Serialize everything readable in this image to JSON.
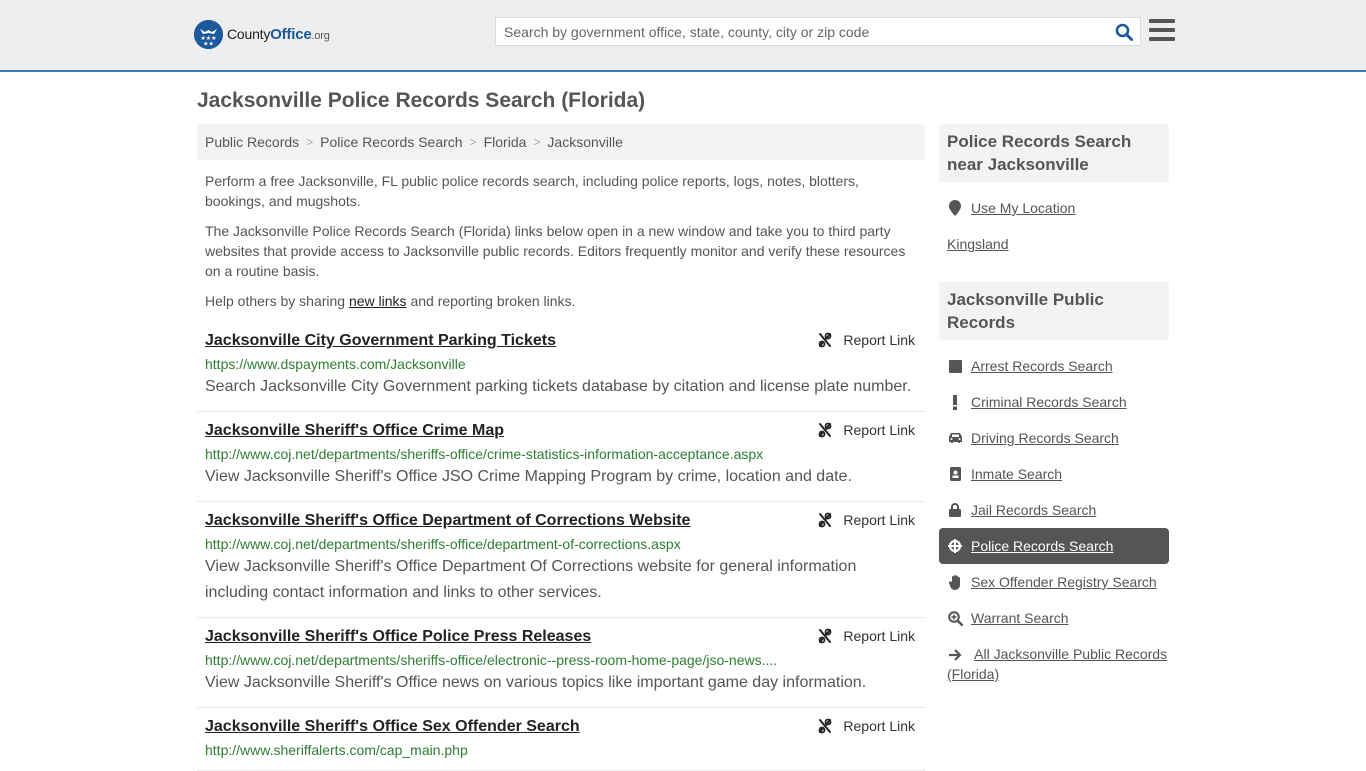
{
  "header": {
    "logo": {
      "name": "County",
      "name_bold": "Office",
      "tld": ".org"
    },
    "search": {
      "placeholder": "Search by government office, state, county, city or zip code",
      "value": ""
    },
    "icons": {
      "search": "search-icon",
      "menu": "hamburger-menu-icon"
    }
  },
  "page": {
    "title": "Jacksonville Police Records Search (Florida)"
  },
  "breadcrumb": [
    {
      "label": "Public Records"
    },
    {
      "label": "Police Records Search"
    },
    {
      "label": "Florida"
    },
    {
      "label": "Jacksonville"
    }
  ],
  "intro": {
    "p1": "Perform a free Jacksonville, FL public police records search, including police reports, logs, notes, blotters, bookings, and mugshots.",
    "p2": "The Jacksonville Police Records Search (Florida) links below open in a new window and take you to third party websites that provide access to Jacksonville public records. Editors frequently monitor and verify these resources on a routine basis.",
    "p3_before": "Help others by sharing ",
    "p3_link": "new links",
    "p3_after": " and reporting broken links."
  },
  "results": [
    {
      "title": "Jacksonville City Government Parking Tickets",
      "url": "https://www.dspayments.com/Jacksonville",
      "description": "Search Jacksonville City Government parking tickets database by citation and license plate number.",
      "report_label": "Report Link"
    },
    {
      "title": "Jacksonville Sheriff's Office Crime Map",
      "url": "http://www.coj.net/departments/sheriffs-office/crime-statistics-information-acceptance.aspx",
      "description": "View Jacksonville Sheriff's Office JSO Crime Mapping Program by crime, location and date.",
      "report_label": "Report Link"
    },
    {
      "title": "Jacksonville Sheriff's Office Department of Corrections Website",
      "url": "http://www.coj.net/departments/sheriffs-office/department-of-corrections.aspx",
      "description": "View Jacksonville Sheriff's Office Department Of Corrections website for general information including contact information and links to other services.",
      "report_label": "Report Link"
    },
    {
      "title": "Jacksonville Sheriff's Office Police Press Releases",
      "url": "http://www.coj.net/departments/sheriffs-office/electronic--press-room-home-page/jso-news....",
      "description": "View Jacksonville Sheriff's Office news on various topics like important game day information.",
      "report_label": "Report Link"
    },
    {
      "title": "Jacksonville Sheriff's Office Sex Offender Search",
      "url": "http://www.sheriffalerts.com/cap_main.php",
      "description": "",
      "report_label": "Report Link"
    }
  ],
  "sidebar": {
    "nearby": {
      "heading": "Police Records Search near Jacksonville",
      "use_location": "Use My Location",
      "places": [
        "Kingsland"
      ]
    },
    "public_records": {
      "heading": "Jacksonville Public Records",
      "items": [
        {
          "label": "Arrest Records Search",
          "icon": "square-icon",
          "active": false
        },
        {
          "label": "Criminal Records Search",
          "icon": "exclamation-icon",
          "active": false
        },
        {
          "label": "Driving Records Search",
          "icon": "car-icon",
          "active": false
        },
        {
          "label": "Inmate Search",
          "icon": "id-badge-icon",
          "active": false
        },
        {
          "label": "Jail Records Search",
          "icon": "lock-icon",
          "active": false
        },
        {
          "label": "Police Records Search",
          "icon": "crosshairs-icon",
          "active": true
        },
        {
          "label": "Sex Offender Registry Search",
          "icon": "hand-icon",
          "active": false
        },
        {
          "label": "Warrant Search",
          "icon": "search-plus-icon",
          "active": false
        },
        {
          "label": "All Jacksonville Public Records (Florida)",
          "icon": "arrow-right-icon",
          "active": false
        }
      ]
    }
  },
  "colors": {
    "brand_blue": "#1a5a9c",
    "header_border": "#3a7eb5",
    "url_green": "#2e7d32",
    "active_bg": "#555555"
  }
}
